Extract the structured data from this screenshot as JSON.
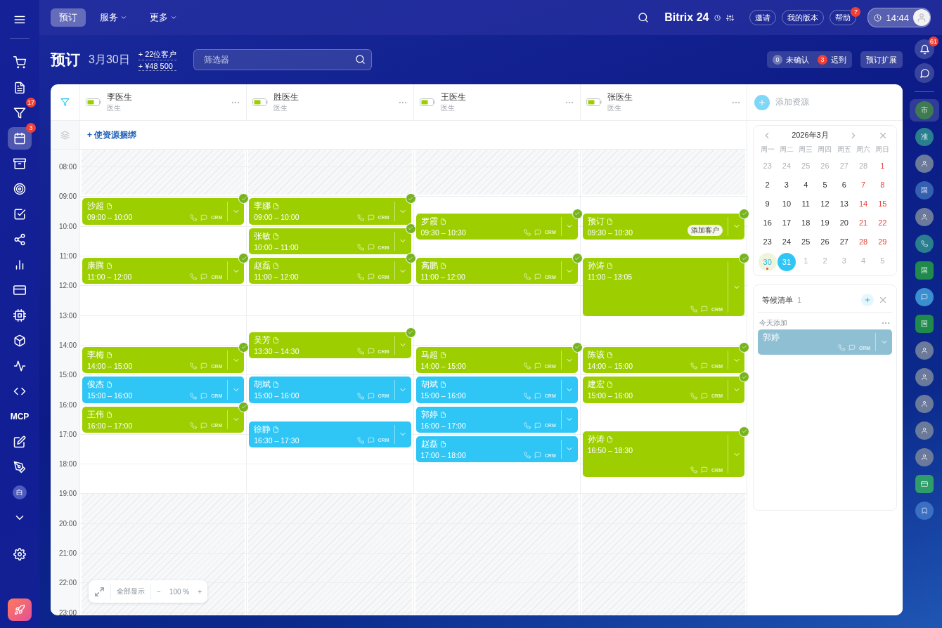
{
  "sidebar": {
    "items": [
      {
        "kind": "icon",
        "selected": false
      },
      {
        "kind": "icon",
        "selected": false
      },
      {
        "kind": "icon",
        "badge": "17",
        "selected": false
      },
      {
        "kind": "icon",
        "badge": "3",
        "selected": true
      },
      {
        "kind": "icon",
        "selected": false
      },
      {
        "kind": "icon",
        "selected": false
      },
      {
        "kind": "icon",
        "selected": false
      },
      {
        "kind": "icon",
        "selected": false
      },
      {
        "kind": "icon",
        "selected": false
      },
      {
        "kind": "icon",
        "selected": false
      },
      {
        "kind": "icon",
        "selected": false
      },
      {
        "kind": "icon",
        "selected": false
      },
      {
        "kind": "icon",
        "selected": false
      },
      {
        "kind": "icon",
        "selected": false
      },
      {
        "kind": "text",
        "text": "MCP",
        "selected": false
      },
      {
        "kind": "icon",
        "selected": false
      },
      {
        "kind": "icon",
        "selected": false
      },
      {
        "kind": "letter",
        "text": "白",
        "selected": false
      },
      {
        "kind": "icon",
        "selected": false
      }
    ]
  },
  "top_bar": {
    "tabs": [
      {
        "label": "预订",
        "selected": true,
        "dropdown": false
      },
      {
        "label": "服务",
        "selected": false,
        "dropdown": true
      },
      {
        "label": "更多",
        "selected": false,
        "dropdown": true
      }
    ],
    "logo": "Bitrix 24",
    "buttons": [
      {
        "label": "邀请"
      },
      {
        "label": "我的版本"
      },
      {
        "label": "帮助",
        "badge": "7"
      }
    ],
    "time": "14:44"
  },
  "header": {
    "title": "预订",
    "date": "3月30日",
    "stats": [
      "+ 22位客户",
      "+ ¥48 500"
    ],
    "filter": {
      "placeholder": "筛选器"
    },
    "counters": [
      {
        "count": "0",
        "label": "未确认",
        "alert": false
      },
      {
        "count": "3",
        "label": "迟到",
        "alert": true
      }
    ],
    "extension_button": "预订扩展"
  },
  "resources": [
    {
      "name": "李医生",
      "role": "医生",
      "bookings": [
        {
          "name": "沙超",
          "time": "09:00 – 10:00",
          "color": "#9dcf00",
          "confirmed": true,
          "kind": "client",
          "crm": "CRM"
        },
        {
          "name": "康腾",
          "time": "11:00 – 12:00",
          "color": "#9dcf00",
          "confirmed": true,
          "kind": "client",
          "crm": "CRM"
        },
        {
          "name": "李梅",
          "time": "14:00 – 15:00",
          "color": "#9dcf00",
          "confirmed": true,
          "kind": "client",
          "crm": "CRM"
        },
        {
          "name": "俊杰",
          "time": "15:00 – 16:00",
          "color": "#2fc6f6",
          "confirmed": false,
          "kind": "client",
          "crm": "CRM"
        },
        {
          "name": "王伟",
          "time": "16:00 – 17:00",
          "color": "#9dcf00",
          "confirmed": true,
          "kind": "client",
          "crm": "CRM"
        }
      ]
    },
    {
      "name": "胜医生",
      "role": "医生",
      "bookings": [
        {
          "name": "李娜",
          "time": "09:00 – 10:00",
          "color": "#9dcf00",
          "confirmed": true,
          "kind": "client",
          "crm": "CRM"
        },
        {
          "name": "张敏",
          "time": "10:00 – 11:00",
          "color": "#9dcf00",
          "confirmed": true,
          "kind": "client",
          "crm": "CRM"
        },
        {
          "name": "赵磊",
          "time": "11:00 – 12:00",
          "color": "#9dcf00",
          "confirmed": true,
          "kind": "client",
          "crm": "CRM"
        },
        {
          "name": "吴芳",
          "time": "13:30 – 14:30",
          "color": "#9dcf00",
          "confirmed": true,
          "kind": "client",
          "crm": "CRM"
        },
        {
          "name": "胡斌",
          "time": "15:00 – 16:00",
          "color": "#2fc6f6",
          "confirmed": false,
          "kind": "client",
          "crm": "CRM"
        },
        {
          "name": "徐静",
          "time": "16:30 – 17:30",
          "color": "#2fc6f6",
          "confirmed": false,
          "kind": "client",
          "crm": "CRM"
        }
      ]
    },
    {
      "name": "王医生",
      "role": "医生",
      "bookings": [
        {
          "name": "罗霞",
          "time": "09:30 – 10:30",
          "color": "#9dcf00",
          "confirmed": true,
          "kind": "client",
          "crm": "CRM"
        },
        {
          "name": "高鹏",
          "time": "11:00 – 12:00",
          "color": "#9dcf00",
          "confirmed": true,
          "kind": "client",
          "crm": "CRM"
        },
        {
          "name": "马超",
          "time": "14:00 – 15:00",
          "color": "#9dcf00",
          "confirmed": true,
          "kind": "client",
          "crm": "CRM"
        },
        {
          "name": "胡斌",
          "time": "15:00 – 16:00",
          "color": "#2fc6f6",
          "confirmed": false,
          "kind": "client",
          "crm": "CRM"
        },
        {
          "name": "郭婷",
          "time": "16:00 – 17:00",
          "color": "#2fc6f6",
          "confirmed": false,
          "kind": "client",
          "crm": "CRM"
        },
        {
          "name": "赵磊",
          "time": "17:00 – 18:00",
          "color": "#2fc6f6",
          "confirmed": false,
          "kind": "client",
          "crm": "CRM"
        }
      ]
    },
    {
      "name": "张医生",
      "role": "医生",
      "bookings": [
        {
          "name": "预订",
          "time": "09:30 – 10:30",
          "color": "#9dcf00",
          "confirmed": true,
          "kind": "no-client",
          "action": "添加客户"
        },
        {
          "name": "孙涛",
          "time": "11:00 – 13:05",
          "color": "#9dcf00",
          "confirmed": true,
          "kind": "client",
          "crm": "CRM"
        },
        {
          "name": "陈该",
          "time": "14:00 – 15:00",
          "color": "#9dcf00",
          "confirmed": true,
          "kind": "client",
          "crm": "CRM"
        },
        {
          "name": "建宏",
          "time": "15:00 – 16:00",
          "color": "#9dcf00",
          "confirmed": true,
          "kind": "client",
          "crm": "CRM"
        },
        {
          "name": "孙涛",
          "time": "16:50 – 18:30",
          "color": "#9dcf00",
          "confirmed": true,
          "kind": "client",
          "crm": "CRM"
        }
      ]
    }
  ],
  "add_resource": "添加资源",
  "bind_resources": "+ 使资源捆绑",
  "time_labels": [
    "08:00",
    "09:00",
    "10:00",
    "11:00",
    "12:00",
    "13:00",
    "14:00",
    "15:00",
    "16:00",
    "17:00",
    "18:00",
    "19:00",
    "20:00",
    "21:00",
    "22:00",
    "23:00"
  ],
  "zoom_control": {
    "fit": "全部显示",
    "minus": "−",
    "value": "100 %",
    "plus": "+"
  },
  "mini_calendar": {
    "title": "2026年3月",
    "weekdays": [
      "周一",
      "周二",
      "周三",
      "周四",
      "周五",
      "周六",
      "周日"
    ],
    "weeks": [
      [
        {
          "day": "23",
          "muted": true,
          "today": false,
          "selected": false
        },
        {
          "day": "24",
          "muted": true,
          "today": false,
          "selected": false
        },
        {
          "day": "25",
          "muted": true,
          "today": false,
          "selected": false
        },
        {
          "day": "26",
          "muted": true,
          "today": false,
          "selected": false
        },
        {
          "day": "27",
          "muted": true,
          "today": false,
          "selected": false
        },
        {
          "day": "28",
          "muted": true,
          "today": false,
          "selected": false
        },
        {
          "day": "1",
          "muted": false,
          "today": false,
          "selected": false
        }
      ],
      [
        {
          "day": "2",
          "muted": false,
          "today": false,
          "selected": false
        },
        {
          "day": "3",
          "muted": false,
          "today": false,
          "selected": false
        },
        {
          "day": "4",
          "muted": false,
          "today": false,
          "selected": false
        },
        {
          "day": "5",
          "muted": false,
          "today": false,
          "selected": false
        },
        {
          "day": "6",
          "muted": false,
          "today": false,
          "selected": false
        },
        {
          "day": "7",
          "muted": false,
          "today": false,
          "selected": false
        },
        {
          "day": "8",
          "muted": false,
          "today": false,
          "selected": false
        }
      ],
      [
        {
          "day": "9",
          "muted": false,
          "today": false,
          "selected": false
        },
        {
          "day": "10",
          "muted": false,
          "today": false,
          "selected": false
        },
        {
          "day": "11",
          "muted": false,
          "today": false,
          "selected": false
        },
        {
          "day": "12",
          "muted": false,
          "today": false,
          "selected": false
        },
        {
          "day": "13",
          "muted": false,
          "today": false,
          "selected": false
        },
        {
          "day": "14",
          "muted": false,
          "today": false,
          "selected": false
        },
        {
          "day": "15",
          "muted": false,
          "today": false,
          "selected": false
        }
      ],
      [
        {
          "day": "16",
          "muted": false,
          "today": false,
          "selected": false
        },
        {
          "day": "17",
          "muted": false,
          "today": false,
          "selected": false
        },
        {
          "day": "18",
          "muted": false,
          "today": false,
          "selected": false
        },
        {
          "day": "19",
          "muted": false,
          "today": false,
          "selected": false
        },
        {
          "day": "20",
          "muted": false,
          "today": false,
          "selected": false
        },
        {
          "day": "21",
          "muted": false,
          "today": false,
          "selected": false
        },
        {
          "day": "22",
          "muted": false,
          "today": false,
          "selected": false
        }
      ],
      [
        {
          "day": "23",
          "muted": false,
          "today": false,
          "selected": false
        },
        {
          "day": "24",
          "muted": false,
          "today": false,
          "selected": false
        },
        {
          "day": "25",
          "muted": false,
          "today": false,
          "selected": false
        },
        {
          "day": "26",
          "muted": false,
          "today": false,
          "selected": false
        },
        {
          "day": "27",
          "muted": false,
          "today": false,
          "selected": false
        },
        {
          "day": "28",
          "muted": false,
          "today": false,
          "selected": false
        },
        {
          "day": "29",
          "muted": false,
          "today": false,
          "selected": false
        }
      ],
      [
        {
          "day": "30",
          "muted": false,
          "today": true,
          "selected": false
        },
        {
          "day": "31",
          "muted": false,
          "today": false,
          "selected": true
        },
        {
          "day": "1",
          "muted": true,
          "today": false,
          "selected": false
        },
        {
          "day": "2",
          "muted": true,
          "today": false,
          "selected": false
        },
        {
          "day": "3",
          "muted": true,
          "today": false,
          "selected": false
        },
        {
          "day": "4",
          "muted": true,
          "today": false,
          "selected": false
        },
        {
          "day": "5",
          "muted": true,
          "today": false,
          "selected": false
        }
      ]
    ]
  },
  "waitlist": {
    "title": "等候清单",
    "count": "1",
    "section": "今天添加",
    "items": [
      {
        "name": "郭婷",
        "crm": "CRM",
        "color": "#8fbfd3"
      }
    ]
  },
  "right_rail": {
    "notifications_badge": "61",
    "contacts": [
      {
        "kind": "letter",
        "text": "市",
        "color": "#3e7b52",
        "selected": true
      },
      {
        "kind": "letter",
        "text": "准",
        "color": "#2a7f8f",
        "selected": false
      },
      {
        "kind": "photo",
        "selected": false
      },
      {
        "kind": "letter",
        "text": "国",
        "color": "#3560b0",
        "selected": false
      },
      {
        "kind": "photo",
        "selected": false
      },
      {
        "kind": "phone",
        "color": "#2a7f8f",
        "selected": false
      },
      {
        "kind": "hex",
        "text": "国",
        "color": "#1f8a4c",
        "selected": false
      },
      {
        "kind": "chat",
        "color": "#3a8fd0",
        "selected": false
      },
      {
        "kind": "hex",
        "text": "国",
        "color": "#1f8a4c",
        "selected": false
      },
      {
        "kind": "photo",
        "selected": false
      },
      {
        "kind": "photo",
        "selected": false
      },
      {
        "kind": "photo",
        "selected": false
      },
      {
        "kind": "photo",
        "selected": false
      },
      {
        "kind": "photo",
        "selected": false
      },
      {
        "kind": "square",
        "color": "#2f9c6a",
        "selected": false
      },
      {
        "kind": "bookmark",
        "color": "#3b6fc4",
        "selected": false
      }
    ]
  }
}
